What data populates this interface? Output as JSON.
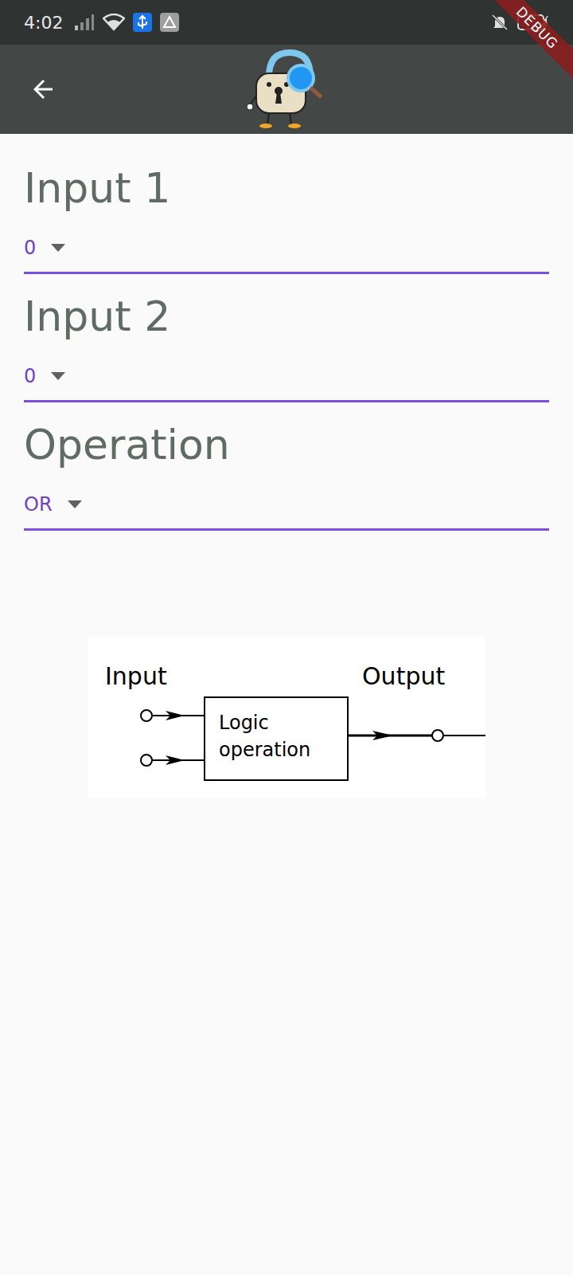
{
  "status_bar": {
    "time": "4:02"
  },
  "debug_banner": "DEBUG",
  "fields": [
    {
      "label": "Input 1",
      "value": "0"
    },
    {
      "label": "Input 2",
      "value": "0"
    },
    {
      "label": "Operation",
      "value": "OR"
    }
  ],
  "diagram": {
    "input_label": "Input",
    "output_label": "Output",
    "box_lines": [
      "Logic",
      "operation"
    ]
  }
}
